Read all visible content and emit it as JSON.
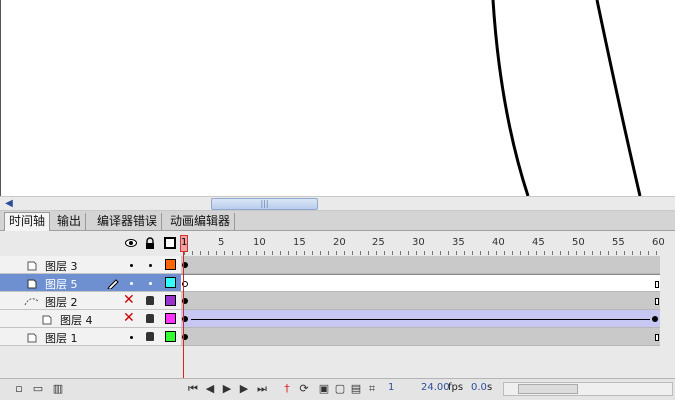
{
  "tabs": [
    "时间轴",
    "输出",
    "编译器错误",
    "动画编辑器"
  ],
  "ruler": {
    "current_frame": "1",
    "labels": [
      "5",
      "10",
      "15",
      "20",
      "25",
      "30",
      "35",
      "40",
      "45",
      "50",
      "55",
      "60"
    ]
  },
  "layers": [
    {
      "name": "图层 3",
      "type": "normal",
      "color": "#ff6600",
      "frames": "gray"
    },
    {
      "name": "图层 5",
      "type": "normal",
      "color": "#33ffff",
      "frames": "white",
      "selected": true
    },
    {
      "name": "图层 2",
      "type": "guide",
      "color": "#9933cc",
      "frames": "gray"
    },
    {
      "name": "图层 4",
      "type": "guided",
      "color": "#ff33ff",
      "frames": "tween"
    },
    {
      "name": "图层 1",
      "type": "normal",
      "color": "#33ff33",
      "frames": "gray"
    }
  ],
  "status": {
    "frame": "1",
    "fps": "24.00",
    "fps_unit": "fps",
    "time": "0.0",
    "time_unit": "s"
  },
  "icons": {
    "eye": "eye-icon",
    "lock": "lock-icon",
    "outline": "outline-icon",
    "pencil": "pencil-icon",
    "new_layer": "new-layer-icon",
    "new_folder": "new-folder-icon",
    "delete": "trash-icon"
  }
}
